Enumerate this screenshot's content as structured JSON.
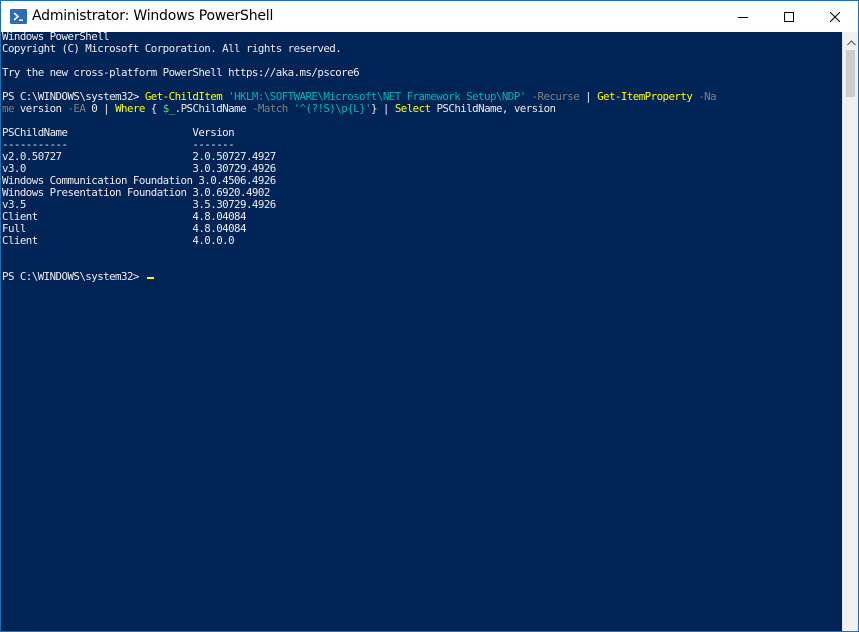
{
  "window": {
    "title": "Administrator: Windows PowerShell",
    "accent_color": "#1f6fb5",
    "console_background": "#012456",
    "icons": {
      "app": "powershell-icon",
      "minimize": "minimize-icon",
      "maximize": "maximize-icon",
      "close": "close-icon",
      "scroll_up": "chevron-up-icon"
    }
  },
  "console": {
    "lines": [
      {
        "segments": [
          {
            "type": "text",
            "text": "Windows PowerShell"
          }
        ]
      },
      {
        "segments": [
          {
            "type": "text",
            "text": "Copyright (C) Microsoft Corporation. All rights reserved."
          }
        ]
      },
      {
        "segments": []
      },
      {
        "segments": [
          {
            "type": "text",
            "text": "Try the new cross-platform PowerShell https://aka.ms/pscore6"
          }
        ]
      },
      {
        "segments": []
      },
      {
        "segments": [
          {
            "type": "text",
            "text": "PS C:\\WINDOWS\\system32> "
          },
          {
            "type": "cmd",
            "text": "Get-ChildItem"
          },
          {
            "type": "text",
            "text": " "
          },
          {
            "type": "str",
            "text": "'HKLM:\\SOFTWARE\\Microsoft\\NET Framework Setup\\NDP'"
          },
          {
            "type": "text",
            "text": " "
          },
          {
            "type": "param",
            "text": "-Recurse"
          },
          {
            "type": "text",
            "text": " | "
          },
          {
            "type": "cmd",
            "text": "Get-ItemProperty"
          },
          {
            "type": "text",
            "text": " "
          },
          {
            "type": "param",
            "text": "-Na"
          }
        ]
      },
      {
        "segments": [
          {
            "type": "param",
            "text": "me"
          },
          {
            "type": "text",
            "text": " version "
          },
          {
            "type": "param",
            "text": "-EA"
          },
          {
            "type": "text",
            "text": " 0 | "
          },
          {
            "type": "cmd",
            "text": "Where"
          },
          {
            "type": "text",
            "text": " { "
          },
          {
            "type": "var",
            "text": "$_"
          },
          {
            "type": "text",
            "text": ".PSChildName "
          },
          {
            "type": "param",
            "text": "-Match"
          },
          {
            "type": "text",
            "text": " "
          },
          {
            "type": "str",
            "text": "'^(?!S)\\p{L}'"
          },
          {
            "type": "text",
            "text": "} | "
          },
          {
            "type": "cmd",
            "text": "Select"
          },
          {
            "type": "text",
            "text": " PSChildName, version"
          }
        ]
      },
      {
        "segments": []
      },
      {
        "segments": [
          {
            "type": "text",
            "text": "PSChildName                     Version"
          }
        ]
      },
      {
        "segments": [
          {
            "type": "text",
            "text": "-----------                     -------"
          }
        ]
      },
      {
        "segments": [
          {
            "type": "text",
            "text": "v2.0.50727                      2.0.50727.4927"
          }
        ]
      },
      {
        "segments": [
          {
            "type": "text",
            "text": "v3.0                            3.0.30729.4926"
          }
        ]
      },
      {
        "segments": [
          {
            "type": "text",
            "text": "Windows Communication Foundation 3.0.4506.4926"
          }
        ]
      },
      {
        "segments": [
          {
            "type": "text",
            "text": "Windows Presentation Foundation 3.0.6920.4902"
          }
        ]
      },
      {
        "segments": [
          {
            "type": "text",
            "text": "v3.5                            3.5.30729.4926"
          }
        ]
      },
      {
        "segments": [
          {
            "type": "text",
            "text": "Client                          4.8.04084"
          }
        ]
      },
      {
        "segments": [
          {
            "type": "text",
            "text": "Full                            4.8.04084"
          }
        ]
      },
      {
        "segments": [
          {
            "type": "text",
            "text": "Client                          4.0.0.0"
          }
        ]
      },
      {
        "segments": []
      },
      {
        "segments": []
      },
      {
        "segments": [
          {
            "type": "text",
            "text": "PS C:\\WINDOWS\\system32> "
          }
        ],
        "cursor": true
      }
    ]
  }
}
